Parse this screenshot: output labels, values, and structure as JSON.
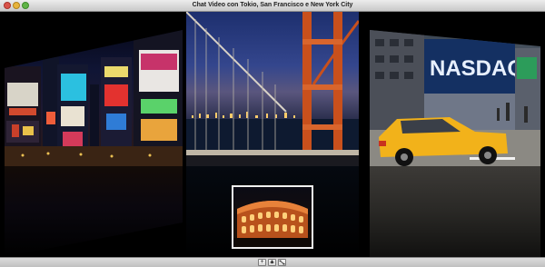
{
  "window": {
    "title": "Chat Video con Tokio, San Francisco e New York City"
  },
  "participants": [
    {
      "name": "Tokio"
    },
    {
      "name": "San Francisco"
    },
    {
      "name": "New York City",
      "sign_text": "NASDAQ"
    }
  ],
  "preview": {
    "scene": "colosseum"
  },
  "toolbar": {
    "buttons": [
      {
        "name": "add-participant",
        "icon": "plus-icon",
        "glyph": "+"
      },
      {
        "name": "mute",
        "icon": "microphone-icon",
        "glyph": ""
      },
      {
        "name": "fullscreen",
        "icon": "fullscreen-icon",
        "glyph": ""
      }
    ]
  },
  "colors": {
    "background": "#000000",
    "titlebar": "#d6d6d6",
    "close": "#d9534a",
    "minimize": "#e7b43c",
    "zoom": "#5fb446",
    "taxi": "#f2b21a",
    "bridge": "#c9501c"
  }
}
